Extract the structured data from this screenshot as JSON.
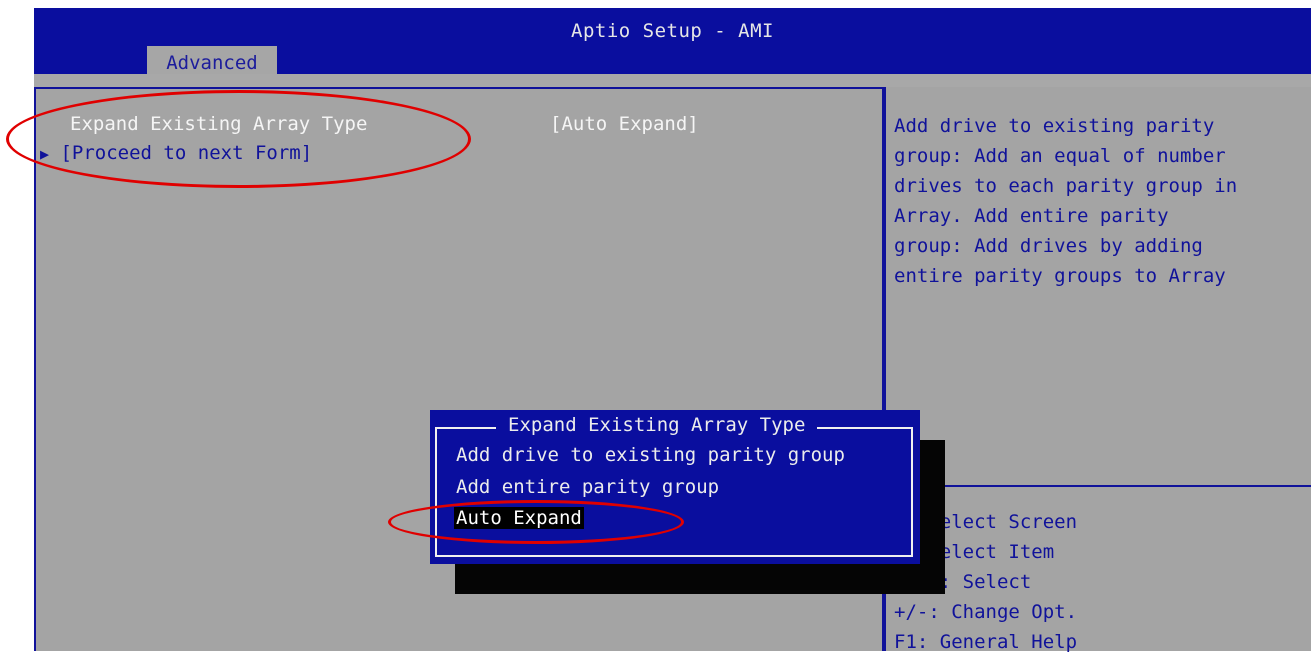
{
  "header": {
    "title": "Aptio Setup - AMI",
    "active_tab": "Advanced"
  },
  "main": {
    "setting": {
      "label": "Expand Existing Array Type",
      "value": "[Auto Expand]"
    },
    "proceed": {
      "label": "[Proceed to next Form]"
    }
  },
  "help": {
    "lines": [
      "Add drive to existing parity",
      "group: Add an equal of number",
      "drives to each parity group in",
      "Array. Add entire parity",
      "group: Add drives by adding",
      "entire parity groups to Array"
    ]
  },
  "keys": {
    "lines": [
      "Select Screen",
      "Select Item",
      "r: Select",
      "+/-: Change Opt.",
      "F1: General Help"
    ]
  },
  "popup": {
    "title": "Expand Existing Array Type",
    "options": [
      "Add drive to existing parity group",
      "Add entire parity group",
      "Auto Expand"
    ],
    "selected_option": "Auto Expand"
  },
  "colors": {
    "bios_blue": "#0a0e9e",
    "panel_gray": "#a4a4a4",
    "annotation_red": "#e00000"
  }
}
